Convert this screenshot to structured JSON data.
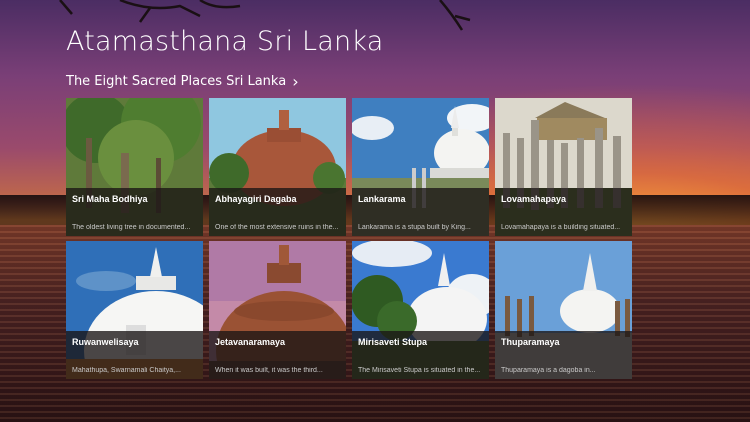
{
  "app": {
    "title": "Atamasthana Sri Lanka"
  },
  "section": {
    "header": "The Eight Sacred Places Sri Lanka",
    "chevron": "›"
  },
  "tiles": [
    {
      "title": "Sri Maha Bodhiya",
      "subtitle": "The oldest living tree in documented..."
    },
    {
      "title": "Abhayagiri Dagaba",
      "subtitle": "One of the most extensive ruins in the..."
    },
    {
      "title": "Lankarama",
      "subtitle": "Lankarama is a stupa built by King..."
    },
    {
      "title": "Lovamahapaya",
      "subtitle": "Lovamahapaya is a building situated..."
    },
    {
      "title": "Ruwanwelisaya",
      "subtitle": "Mahathupa, Swarnamali Chaitya,..."
    },
    {
      "title": "Jetavanaramaya",
      "subtitle": "When it was built, it was the third..."
    },
    {
      "title": "Mirisaveti Stupa",
      "subtitle": "The Mirisaveti Stupa is situated in the..."
    },
    {
      "title": "Thuparamaya",
      "subtitle": "Thuparamaya is a dagoba in..."
    }
  ]
}
